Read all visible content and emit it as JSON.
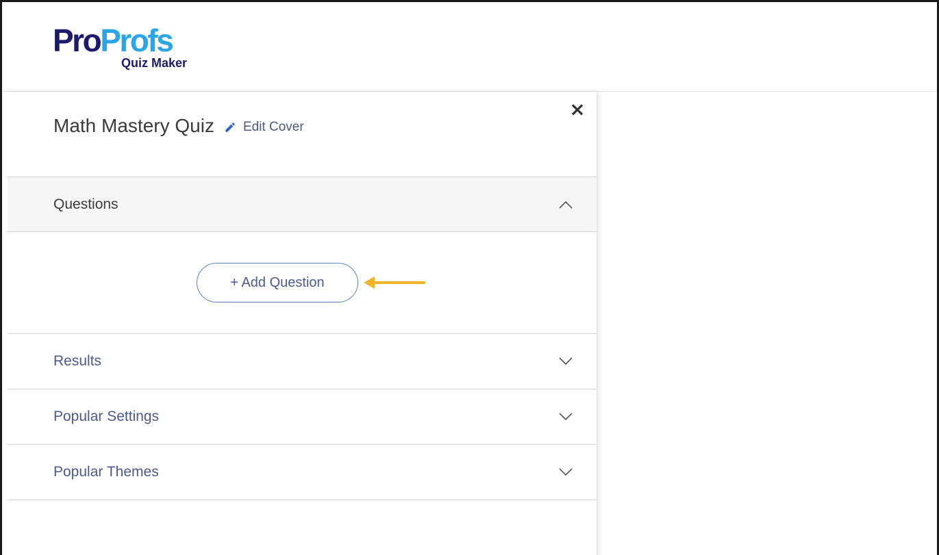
{
  "header": {
    "logo": {
      "brand_part1": "Pro",
      "brand_part2": "Profs",
      "product": "Quiz Maker"
    }
  },
  "panel": {
    "quiz_title": "Math Mastery Quiz",
    "edit_cover_label": "Edit Cover",
    "close_icon": "×",
    "sections": {
      "questions": {
        "label": "Questions",
        "state": "expanded"
      },
      "results": {
        "label": "Results",
        "state": "collapsed"
      },
      "popular_settings": {
        "label": "Popular Settings",
        "state": "collapsed"
      },
      "popular_themes": {
        "label": "Popular Themes",
        "state": "collapsed"
      }
    },
    "add_question_label": "+ Add Question"
  },
  "colors": {
    "brand_dark": "#1c1a6b",
    "brand_light": "#2aa6e6",
    "link": "#4a5a8a",
    "arrow": "#f0b429"
  },
  "icons": {
    "close": "close-icon",
    "edit": "pencil-icon",
    "expanded": "chevron-up-icon",
    "collapsed": "chevron-down-icon",
    "annotation": "arrow-left-icon"
  }
}
